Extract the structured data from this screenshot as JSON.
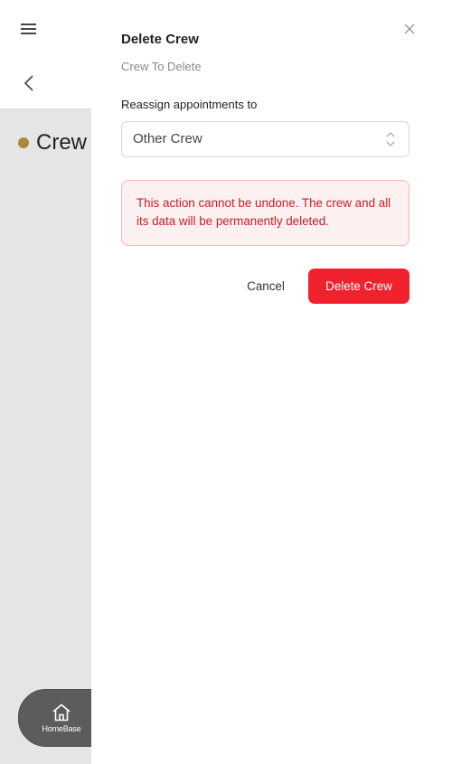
{
  "background": {
    "crew_name": "Crew",
    "crew_dot_color": "#a88a3a",
    "homebase_label": "HomeBase"
  },
  "dialog": {
    "title": "Delete Crew",
    "subtitle": "Crew To Delete",
    "reassign_label": "Reassign appointments to",
    "select_value": "Other Crew",
    "warning": "This action cannot be undone. The crew and all its data will be permanently deleted.",
    "cancel_label": "Cancel",
    "delete_label": "Delete Crew",
    "accent_color": "#f1222e"
  }
}
